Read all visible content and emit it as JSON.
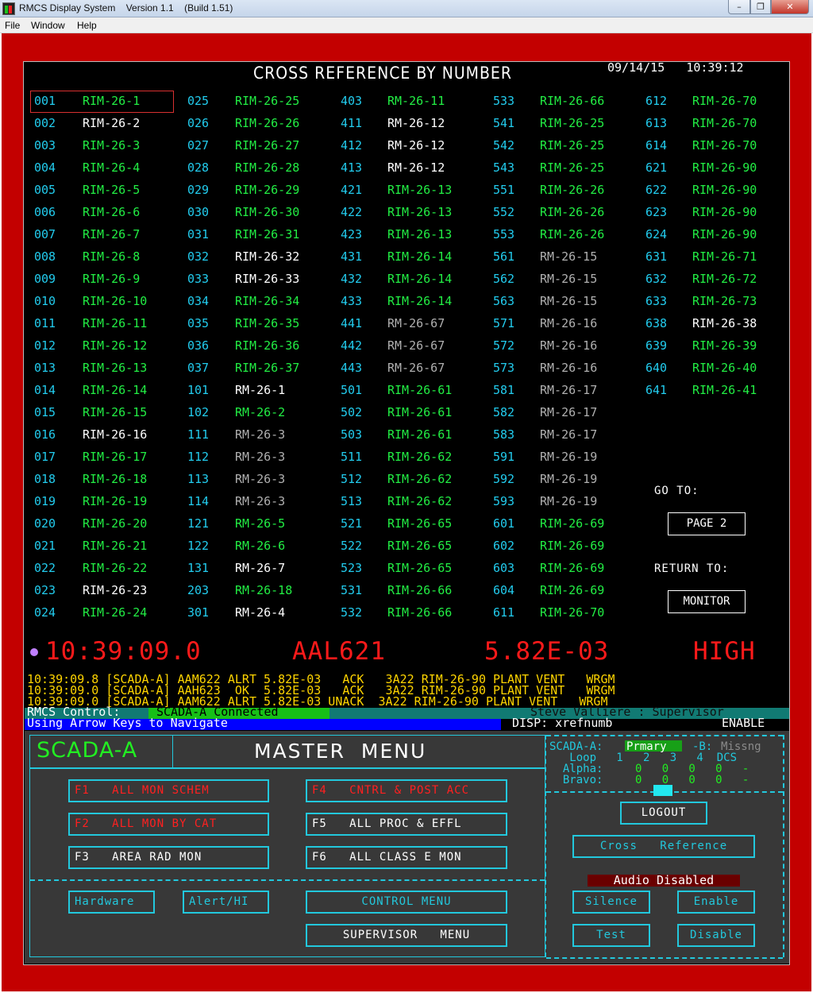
{
  "window": {
    "title": "RMCS Display System    Version 1.1    (Build 1.51)",
    "min": "–",
    "max": "❐",
    "close": "✕"
  },
  "menubar": [
    {
      "label": "File"
    },
    {
      "label": "Window"
    },
    {
      "label": "Help"
    }
  ],
  "screen": {
    "title": "CROSS REFERENCE BY NUMBER",
    "date": "09/14/15",
    "time": "10:39:12"
  },
  "xref": [
    [
      [
        "001",
        "RIM-26-1",
        "g"
      ],
      [
        "002",
        "RIM-26-2",
        "w"
      ],
      [
        "003",
        "RIM-26-3",
        "g"
      ],
      [
        "004",
        "RIM-26-4",
        "g"
      ],
      [
        "005",
        "RIM-26-5",
        "g"
      ],
      [
        "006",
        "RIM-26-6",
        "g"
      ],
      [
        "007",
        "RIM-26-7",
        "g"
      ],
      [
        "008",
        "RIM-26-8",
        "g"
      ],
      [
        "009",
        "RIM-26-9",
        "g"
      ],
      [
        "010",
        "RIM-26-10",
        "g"
      ],
      [
        "011",
        "RIM-26-11",
        "g"
      ],
      [
        "012",
        "RIM-26-12",
        "g"
      ],
      [
        "013",
        "RIM-26-13",
        "g"
      ],
      [
        "014",
        "RIM-26-14",
        "g"
      ],
      [
        "015",
        "RIM-26-15",
        "g"
      ],
      [
        "016",
        "RIM-26-16",
        "w"
      ],
      [
        "017",
        "RIM-26-17",
        "g"
      ],
      [
        "018",
        "RIM-26-18",
        "g"
      ],
      [
        "019",
        "RIM-26-19",
        "g"
      ],
      [
        "020",
        "RIM-26-20",
        "g"
      ],
      [
        "021",
        "RIM-26-21",
        "g"
      ],
      [
        "022",
        "RIM-26-22",
        "g"
      ],
      [
        "023",
        "RIM-26-23",
        "w"
      ],
      [
        "024",
        "RIM-26-24",
        "g"
      ]
    ],
    [
      [
        "025",
        "RIM-26-25",
        "g"
      ],
      [
        "026",
        "RIM-26-26",
        "g"
      ],
      [
        "027",
        "RIM-26-27",
        "g"
      ],
      [
        "028",
        "RIM-26-28",
        "g"
      ],
      [
        "029",
        "RIM-26-29",
        "g"
      ],
      [
        "030",
        "RIM-26-30",
        "g"
      ],
      [
        "031",
        "RIM-26-31",
        "g"
      ],
      [
        "032",
        "RIM-26-32",
        "w"
      ],
      [
        "033",
        "RIM-26-33",
        "w"
      ],
      [
        "034",
        "RIM-26-34",
        "g"
      ],
      [
        "035",
        "RIM-26-35",
        "g"
      ],
      [
        "036",
        "RIM-26-36",
        "g"
      ],
      [
        "037",
        "RIM-26-37",
        "g"
      ],
      [
        "101",
        "RM-26-1",
        "w"
      ],
      [
        "102",
        "RM-26-2",
        "g"
      ],
      [
        "111",
        "RM-26-3",
        "gr"
      ],
      [
        "112",
        "RM-26-3",
        "gr"
      ],
      [
        "113",
        "RM-26-3",
        "gr"
      ],
      [
        "114",
        "RM-26-3",
        "gr"
      ],
      [
        "121",
        "RM-26-5",
        "g"
      ],
      [
        "122",
        "RM-26-6",
        "g"
      ],
      [
        "131",
        "RM-26-7",
        "w"
      ],
      [
        "203",
        "RM-26-18",
        "g"
      ],
      [
        "301",
        "RM-26-4",
        "w"
      ]
    ],
    [
      [
        "403",
        "RM-26-11",
        "g"
      ],
      [
        "411",
        "RM-26-12",
        "w"
      ],
      [
        "412",
        "RM-26-12",
        "w"
      ],
      [
        "413",
        "RM-26-12",
        "w"
      ],
      [
        "421",
        "RIM-26-13",
        "g"
      ],
      [
        "422",
        "RIM-26-13",
        "g"
      ],
      [
        "423",
        "RIM-26-13",
        "g"
      ],
      [
        "431",
        "RIM-26-14",
        "g"
      ],
      [
        "432",
        "RIM-26-14",
        "g"
      ],
      [
        "433",
        "RIM-26-14",
        "g"
      ],
      [
        "441",
        "RM-26-67",
        "gr"
      ],
      [
        "442",
        "RM-26-67",
        "gr"
      ],
      [
        "443",
        "RM-26-67",
        "gr"
      ],
      [
        "501",
        "RIM-26-61",
        "g"
      ],
      [
        "502",
        "RIM-26-61",
        "g"
      ],
      [
        "503",
        "RIM-26-61",
        "g"
      ],
      [
        "511",
        "RIM-26-62",
        "g"
      ],
      [
        "512",
        "RIM-26-62",
        "g"
      ],
      [
        "513",
        "RIM-26-62",
        "g"
      ],
      [
        "521",
        "RIM-26-65",
        "g"
      ],
      [
        "522",
        "RIM-26-65",
        "g"
      ],
      [
        "523",
        "RIM-26-65",
        "g"
      ],
      [
        "531",
        "RIM-26-66",
        "g"
      ],
      [
        "532",
        "RIM-26-66",
        "g"
      ]
    ],
    [
      [
        "533",
        "RIM-26-66",
        "g"
      ],
      [
        "541",
        "RIM-26-25",
        "g"
      ],
      [
        "542",
        "RIM-26-25",
        "g"
      ],
      [
        "543",
        "RIM-26-25",
        "g"
      ],
      [
        "551",
        "RIM-26-26",
        "g"
      ],
      [
        "552",
        "RIM-26-26",
        "g"
      ],
      [
        "553",
        "RIM-26-26",
        "g"
      ],
      [
        "561",
        "RM-26-15",
        "gr"
      ],
      [
        "562",
        "RM-26-15",
        "gr"
      ],
      [
        "563",
        "RM-26-15",
        "gr"
      ],
      [
        "571",
        "RM-26-16",
        "gr"
      ],
      [
        "572",
        "RM-26-16",
        "gr"
      ],
      [
        "573",
        "RM-26-16",
        "gr"
      ],
      [
        "581",
        "RM-26-17",
        "gr"
      ],
      [
        "582",
        "RM-26-17",
        "gr"
      ],
      [
        "583",
        "RM-26-17",
        "gr"
      ],
      [
        "591",
        "RM-26-19",
        "gr"
      ],
      [
        "592",
        "RM-26-19",
        "gr"
      ],
      [
        "593",
        "RM-26-19",
        "gr"
      ],
      [
        "601",
        "RIM-26-69",
        "g"
      ],
      [
        "602",
        "RIM-26-69",
        "g"
      ],
      [
        "603",
        "RIM-26-69",
        "g"
      ],
      [
        "604",
        "RIM-26-69",
        "g"
      ],
      [
        "611",
        "RIM-26-70",
        "g"
      ]
    ],
    [
      [
        "612",
        "RIM-26-70",
        "g"
      ],
      [
        "613",
        "RIM-26-70",
        "g"
      ],
      [
        "614",
        "RIM-26-70",
        "g"
      ],
      [
        "621",
        "RIM-26-90",
        "g"
      ],
      [
        "622",
        "RIM-26-90",
        "g"
      ],
      [
        "623",
        "RIM-26-90",
        "g"
      ],
      [
        "624",
        "RIM-26-90",
        "g"
      ],
      [
        "631",
        "RIM-26-71",
        "g"
      ],
      [
        "632",
        "RIM-26-72",
        "g"
      ],
      [
        "633",
        "RIM-26-73",
        "g"
      ],
      [
        "638",
        "RIM-26-38",
        "w"
      ],
      [
        "639",
        "RIM-26-39",
        "g"
      ],
      [
        "640",
        "RIM-26-40",
        "g"
      ],
      [
        "641",
        "RIM-26-41",
        "g"
      ]
    ]
  ],
  "colors": {
    "g": "#22ee44",
    "w": "#ffffff",
    "gr": "#b0b0b0",
    "num": "#22ccee",
    "frame": "#c30000",
    "alarm": "#ff1a1a",
    "log": "#ffd400"
  },
  "side": {
    "goto_label": "GO TO:",
    "page_btn": "PAGE  2",
    "return_label": "RETURN  TO:",
    "monitor_btn": "MONITOR"
  },
  "alarm": {
    "time": "10:39:09.0",
    "id": "AAL621",
    "value": "5.82E-03",
    "level": "HIGH"
  },
  "log": [
    "10:39:09.8 [SCADA-A] AAM622 ALRT 5.82E-03   ACK   3A22 RIM-26-90 PLANT VENT   WRGM",
    "10:39:09.0 [SCADA-A] AAH623  OK  5.82E-03   ACK   3A22 RIM-26-90 PLANT VENT   WRGM",
    "10:39:09.0 [SCADA-A] AAM622 ALRT 5.82E-03 UNACK  3A22 RIM-26-90 PLANT VENT   WRGM"
  ],
  "status": {
    "control_label": "RMCS Control:",
    "control_value": "SCADA-A Connected",
    "user": "Steve Valliere : Supervisor",
    "nav_hint": "Using Arrow Keys to Navigate",
    "disp": "DISP: xrefnumb",
    "enable": "ENABLE"
  },
  "menu": {
    "scada": "SCADA-A",
    "title": "MASTER  MENU",
    "f1": "F1   ALL MON SCHEM",
    "f2": "F2   ALL MON BY CAT",
    "f3": "F3   AREA RAD MON",
    "f4": "F4   CNTRL & POST ACC",
    "f5": "F5   ALL PROC & EFFL",
    "f6": "F6   ALL CLASS E MON",
    "hardware": "Hardware",
    "alert": "Alert/HI",
    "control": "CONTROL MENU",
    "supervisor": "SUPERVISOR   MENU",
    "logout": "LOGOUT",
    "xref": "Cross   Reference",
    "audio": "Audio Disabled",
    "silence": "Silence",
    "enable": "Enable",
    "test": "Test",
    "disable": "Disable"
  },
  "stat_panel": {
    "a_label": "SCADA-A:",
    "a_value": "Prmary",
    "b_label": "-B:",
    "b_value": "Missng",
    "loop_row": "   Loop   1   2   3   4  DCS",
    "alpha_label": "  Alpha:",
    "alpha_vals": "0   0   0   0   -",
    "bravo_label": "  Bravo:",
    "bravo_vals": "0   0   0   0   -"
  }
}
